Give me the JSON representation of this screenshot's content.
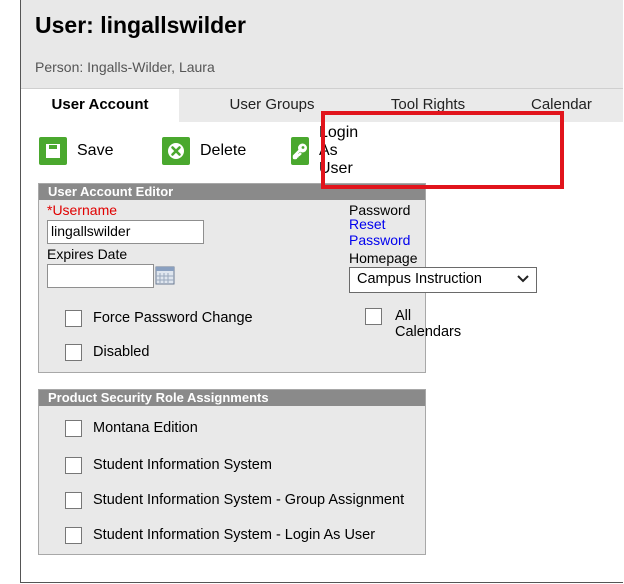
{
  "header": {
    "title": "User: lingallswilder",
    "subtitle": "Person: Ingalls-Wilder, Laura"
  },
  "tabs": [
    {
      "label": "User Account",
      "active": true
    },
    {
      "label": "User Groups",
      "active": false
    },
    {
      "label": "Tool Rights",
      "active": false
    },
    {
      "label": "Calendar",
      "active": false
    }
  ],
  "toolbar": {
    "save_label": "Save",
    "delete_label": "Delete",
    "login_as_label": "Login As User",
    "save_icon": "floppy-icon",
    "delete_icon": "x-circle-icon",
    "login_icon": "key-icon",
    "accent": "#4aa82e"
  },
  "user_account_editor": {
    "title": "User Account Editor",
    "username_label": "*Username",
    "username_value": "lingallswilder",
    "expires_label": "Expires Date",
    "expires_value": "",
    "password_label": "Password",
    "reset_password_link": "Reset Password",
    "homepage_label": "Homepage",
    "homepage_value": "Campus Instruction",
    "force_password_change_label": "Force Password Change",
    "disabled_label": "Disabled",
    "all_calendars_label": "All Calendars"
  },
  "role_assignments": {
    "title": "Product Security Role Assignments",
    "items": [
      {
        "label": "Montana Edition",
        "checked": false
      },
      {
        "label": "Student Information System",
        "checked": false
      },
      {
        "label": "Student Information System - Group Assignment",
        "checked": false
      },
      {
        "label": "Student Information System - Login As User",
        "checked": false
      }
    ]
  },
  "colors": {
    "highlight": "#e1141c",
    "required": "#e00000",
    "link": "#0000ee"
  }
}
